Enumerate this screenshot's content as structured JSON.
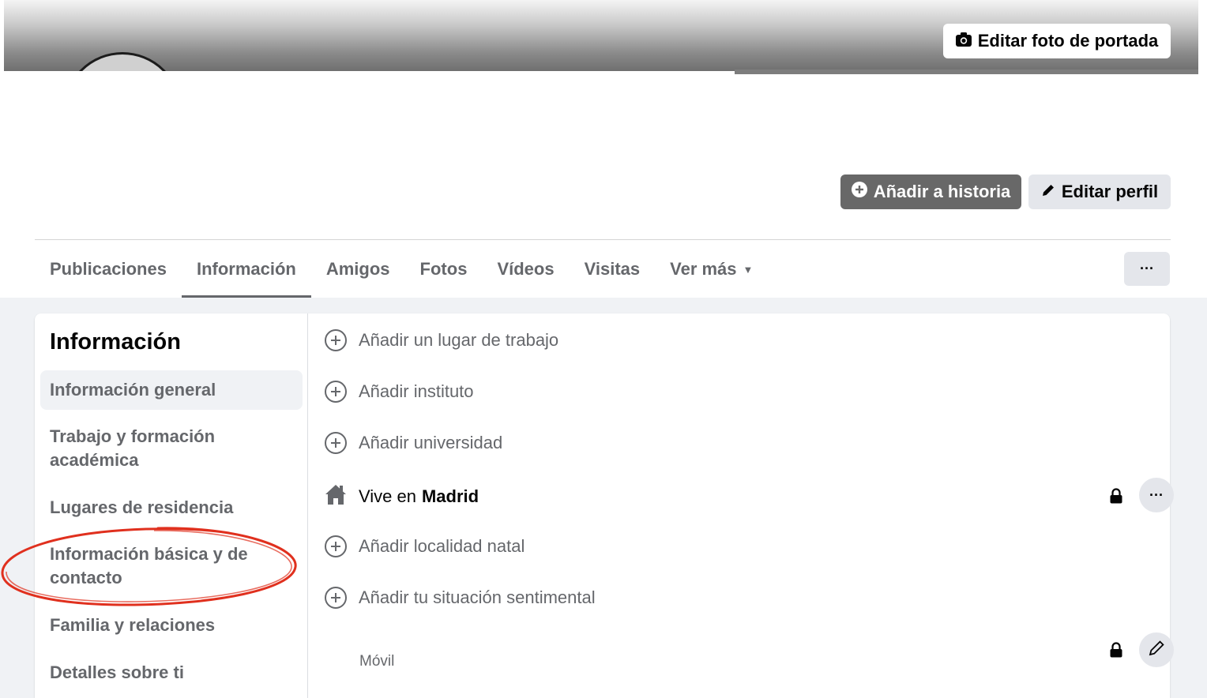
{
  "cover": {
    "edit_cover_label": "Editar foto de portada",
    "camera_icon": "camera-icon"
  },
  "actions": {
    "add_story_label": "Añadir a historia",
    "edit_profile_label": "Editar perfil"
  },
  "tabs": [
    {
      "label": "Publicaciones"
    },
    {
      "label": "Información",
      "active": true
    },
    {
      "label": "Amigos"
    },
    {
      "label": "Fotos"
    },
    {
      "label": "Vídeos"
    },
    {
      "label": "Visitas"
    },
    {
      "label": "Ver más"
    }
  ],
  "more_button": "···",
  "about": {
    "title": "Información",
    "nav": [
      {
        "label": "Información general",
        "selected": true
      },
      {
        "label": "Trabajo y formación académica"
      },
      {
        "label": "Lugares de residencia"
      },
      {
        "label": "Información básica y de contacto",
        "highlighted": true
      },
      {
        "label": "Familia y relaciones"
      },
      {
        "label": "Detalles sobre ti"
      }
    ],
    "rows": {
      "workplace": "Añadir un lugar de trabajo",
      "school": "Añadir instituto",
      "university": "Añadir universidad",
      "lives_prefix": "Vive en",
      "lives_city": "Madrid",
      "hometown": "Añadir localidad natal",
      "relationship": "Añadir tu situación sentimental",
      "mobile_label": "Móvil"
    }
  },
  "colors": {
    "annotation": "#e0301e",
    "secondary_text": "#65676b",
    "button_gray": "#e4e6eb",
    "story_button": "#686868"
  }
}
